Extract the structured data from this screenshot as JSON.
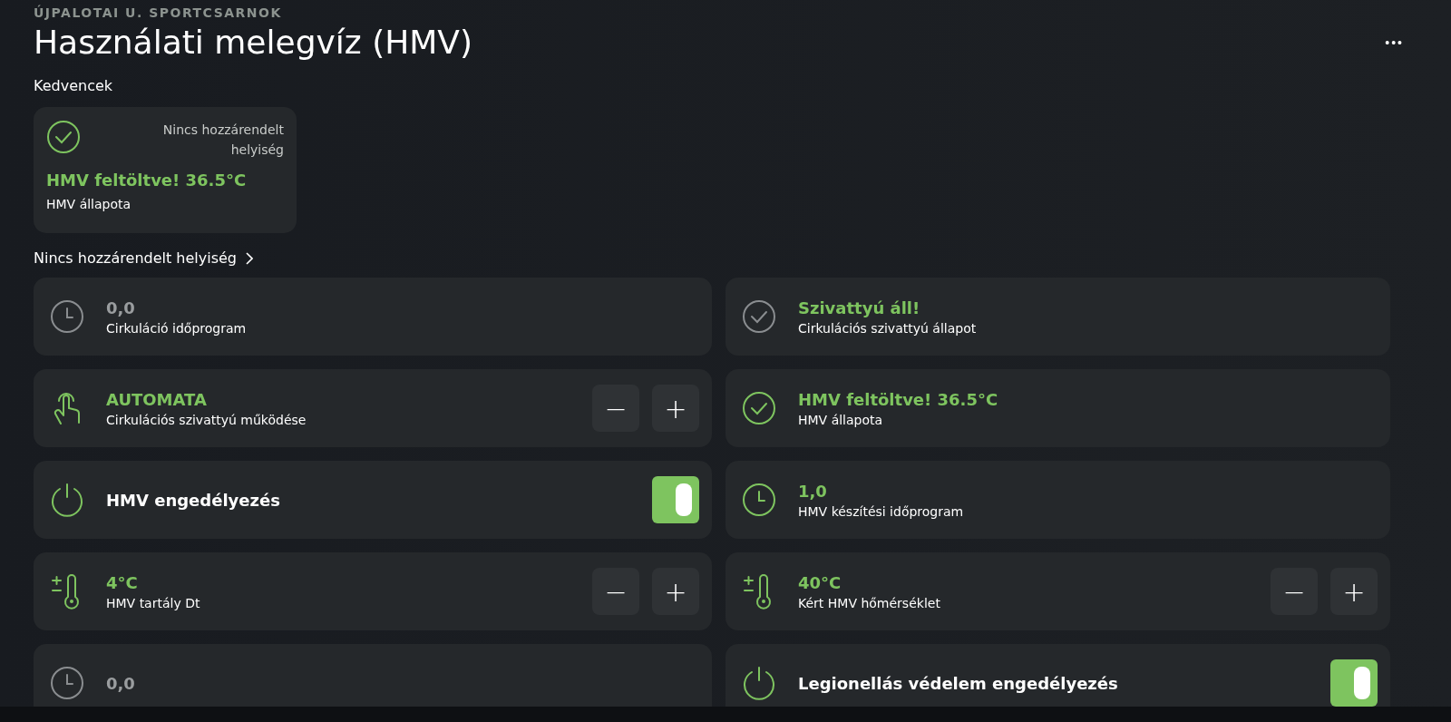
{
  "header": {
    "site": "ÚJPALOTAI U. SPORTCSARNOK",
    "title": "Használati melegvíz (HMV)",
    "menu": "•••"
  },
  "favorites": {
    "title": "Kedvencek",
    "cards": [
      {
        "room": "Nincs hozzárendelt helyiség",
        "value": "HMV feltöltve! 36.5°C",
        "label": "HMV állapota"
      }
    ]
  },
  "room_link": "Nincs hozzárendelt helyiség",
  "tiles": [
    {
      "kind": "status",
      "active": false,
      "value": "0,0",
      "label": "Cirkuláció időprogram"
    },
    {
      "kind": "status",
      "active": false,
      "value_highlighted": true,
      "value": "Szivattyú áll!",
      "label": "Cirkulációs szivattyú állapot"
    },
    {
      "kind": "stepper",
      "active": true,
      "value": "AUTOMATA",
      "label": "Cirkulációs szivattyú működése",
      "minus": "−",
      "plus": "+"
    },
    {
      "kind": "status",
      "active": true,
      "value": "HMV feltöltve! 36.5°C",
      "label": "HMV állapota"
    },
    {
      "kind": "toggle",
      "label": "HMV engedélyezés",
      "on": true
    },
    {
      "kind": "status",
      "active": true,
      "value": "1,0",
      "label": "HMV készítési időprogram"
    },
    {
      "kind": "stepper",
      "active": true,
      "value": "4°C",
      "label": "HMV tartály Dt",
      "minus": "−",
      "plus": "+"
    },
    {
      "kind": "stepper",
      "active": true,
      "value": "40°C",
      "label": "Kért HMV hőmérséklet",
      "minus": "−",
      "plus": "+"
    },
    {
      "kind": "status",
      "active": false,
      "value": "0,0"
    },
    {
      "kind": "toggle",
      "label": "Legionellás védelem engedélyezés",
      "on": true
    }
  ]
}
